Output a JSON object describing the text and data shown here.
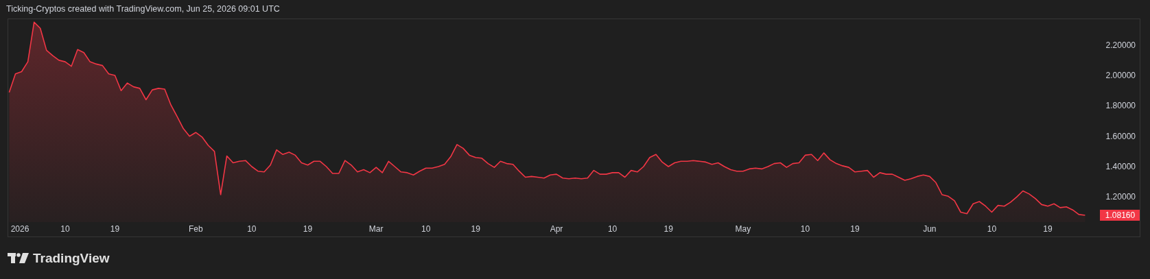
{
  "header": {
    "caption": "Ticking-Cryptos created with TradingView.com, Jun 25, 2026 09:01 UTC"
  },
  "chart": {
    "last_price_label": "1.08160",
    "chart_data": {
      "type": "area",
      "categories": [
        null,
        "2026",
        null,
        null,
        null,
        null,
        null,
        null,
        null,
        "10",
        null,
        null,
        null,
        null,
        null,
        null,
        null,
        "19",
        null,
        null,
        null,
        null,
        null,
        null,
        null,
        null,
        null,
        null,
        null,
        null,
        "Feb",
        null,
        null,
        null,
        null,
        null,
        null,
        null,
        null,
        "10",
        null,
        null,
        null,
        null,
        null,
        null,
        null,
        null,
        "19",
        null,
        null,
        null,
        null,
        null,
        null,
        null,
        null,
        null,
        null,
        "Mar",
        null,
        null,
        null,
        null,
        null,
        null,
        null,
        "10",
        null,
        null,
        null,
        null,
        null,
        null,
        null,
        "19",
        null,
        null,
        null,
        null,
        null,
        null,
        null,
        null,
        null,
        null,
        null,
        null,
        "Apr",
        null,
        null,
        null,
        null,
        null,
        null,
        null,
        null,
        "10",
        null,
        null,
        null,
        null,
        null,
        null,
        null,
        null,
        "19",
        null,
        null,
        null,
        null,
        null,
        null,
        null,
        null,
        null,
        null,
        null,
        "May",
        null,
        null,
        null,
        null,
        null,
        null,
        null,
        null,
        null,
        "10",
        null,
        null,
        null,
        null,
        null,
        null,
        null,
        "19",
        null,
        null,
        null,
        null,
        null,
        null,
        null,
        null,
        null,
        null,
        null,
        "Jun",
        null,
        null,
        null,
        null,
        null,
        null,
        null,
        null,
        null,
        "10",
        null,
        null,
        null,
        null,
        null,
        null,
        null,
        null,
        "19",
        null,
        null,
        null,
        null,
        null,
        null
      ],
      "series": [
        {
          "color": "#f23645",
          "values": [
            1.888,
            2.01,
            2.025,
            2.09,
            2.35,
            2.31,
            2.165,
            2.13,
            2.1,
            2.09,
            2.06,
            2.17,
            2.15,
            2.09,
            2.075,
            2.065,
            2.01,
            2.0,
            1.9,
            1.95,
            1.925,
            1.915,
            1.84,
            1.905,
            1.915,
            1.91,
            1.805,
            1.73,
            1.65,
            1.6,
            1.625,
            1.595,
            1.54,
            1.5,
            1.215,
            1.47,
            1.425,
            1.435,
            1.44,
            1.4,
            1.37,
            1.365,
            1.41,
            1.51,
            1.48,
            1.495,
            1.475,
            1.425,
            1.41,
            1.435,
            1.435,
            1.4,
            1.355,
            1.355,
            1.44,
            1.41,
            1.365,
            1.38,
            1.36,
            1.395,
            1.36,
            1.435,
            1.4,
            1.365,
            1.36,
            1.345,
            1.37,
            1.39,
            1.39,
            1.4,
            1.415,
            1.465,
            1.545,
            1.52,
            1.475,
            1.46,
            1.455,
            1.42,
            1.395,
            1.435,
            1.42,
            1.415,
            1.37,
            1.33,
            1.335,
            1.33,
            1.325,
            1.345,
            1.35,
            1.325,
            1.32,
            1.325,
            1.32,
            1.325,
            1.375,
            1.35,
            1.35,
            1.36,
            1.36,
            1.33,
            1.375,
            1.365,
            1.4,
            1.46,
            1.48,
            1.43,
            1.4,
            1.425,
            1.435,
            1.435,
            1.44,
            1.435,
            1.43,
            1.415,
            1.425,
            1.4,
            1.38,
            1.37,
            1.37,
            1.385,
            1.39,
            1.385,
            1.4,
            1.42,
            1.425,
            1.395,
            1.42,
            1.425,
            1.475,
            1.48,
            1.44,
            1.49,
            1.445,
            1.42,
            1.405,
            1.395,
            1.365,
            1.37,
            1.375,
            1.33,
            1.36,
            1.35,
            1.35,
            1.33,
            1.31,
            1.32,
            1.335,
            1.345,
            1.335,
            1.295,
            1.215,
            1.205,
            1.175,
            1.1,
            1.09,
            1.155,
            1.17,
            1.14,
            1.1,
            1.145,
            1.14,
            1.165,
            1.2,
            1.24,
            1.22,
            1.19,
            1.15,
            1.14,
            1.155,
            1.13,
            1.135,
            1.115,
            1.085,
            1.08
          ]
        }
      ],
      "ylim": [
        0.94,
        2.37
      ],
      "yticks": [
        {
          "value": 1.2,
          "label": "1.20000"
        },
        {
          "value": 1.4,
          "label": "1.40000"
        },
        {
          "value": 1.6,
          "label": "1.60000"
        },
        {
          "value": 1.8,
          "label": "1.80000"
        },
        {
          "value": 2.0,
          "label": "2.00000"
        },
        {
          "value": 2.2,
          "label": "2.20000"
        }
      ]
    }
  },
  "footer": {
    "logo_text": "TradingView"
  }
}
